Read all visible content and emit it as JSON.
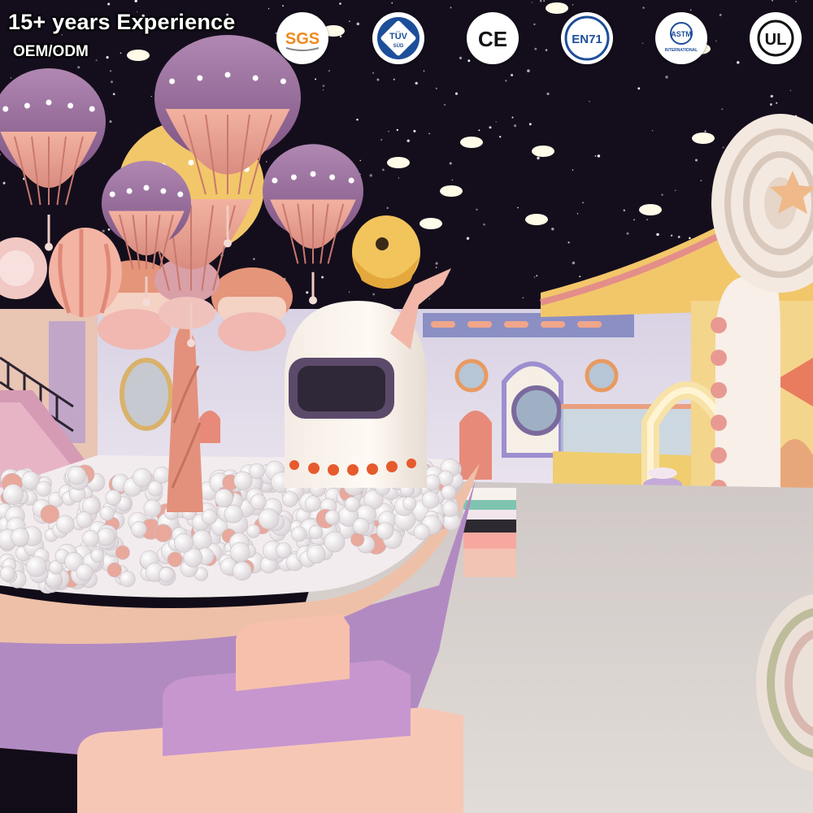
{
  "headline": "15+ years Experience",
  "subline": "OEM/ODM",
  "certifications": [
    {
      "text": "SGS",
      "icon": "sgs-logo-icon"
    },
    {
      "text": "TÜV",
      "sub": "SÜD",
      "icon": "tuv-logo-icon"
    },
    {
      "text": "CE",
      "icon": "ce-mark-icon"
    },
    {
      "text": "EN71",
      "icon": "en71-logo-icon"
    },
    {
      "text": "ASTM",
      "sub": "INTERNATIONAL",
      "icon": "astm-logo-icon"
    },
    {
      "text": "UL",
      "icon": "ul-mark-icon"
    }
  ],
  "colors": {
    "ceiling": "#140e1c",
    "floor": "#d9d4d0",
    "pool_rim": "#e9b8a4",
    "pool_side": "#b08ac0",
    "balloon_top": "#9a6c9c",
    "balloon_bottom": "#e8a090",
    "yellow": "#f2c76a",
    "cert_blue": "#1d4e9a"
  }
}
